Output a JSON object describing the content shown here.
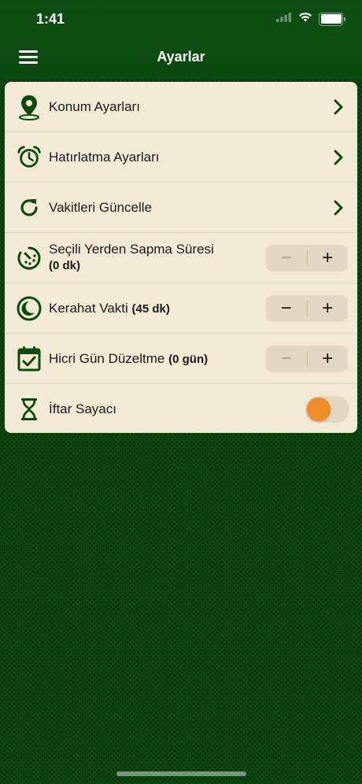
{
  "status_bar": {
    "time": "1:41"
  },
  "nav": {
    "title": "Ayarlar",
    "menu_icon": "hamburger-menu-icon"
  },
  "colors": {
    "header_green": "#0d4f12",
    "background_green": "#0d4a10",
    "card_bg": "#f2ead5",
    "icon_green": "#0d4a10",
    "toggle_knob": "#f08c2a"
  },
  "settings": {
    "location": {
      "label": "Konum Ayarları",
      "icon": "location-pin-icon"
    },
    "reminder": {
      "label": "Hatırlatma Ayarları",
      "icon": "alarm-clock-icon"
    },
    "update": {
      "label": "Vakitleri Güncelle",
      "icon": "refresh-icon"
    },
    "deviation": {
      "label": "Seçili Yerden Sapma Süresi",
      "value": "(0 dk)",
      "icon": "timer-icon",
      "minus": "−",
      "plus": "+"
    },
    "kerahat": {
      "label": "Kerahat Vakti",
      "value": "(45 dk)",
      "icon": "moon-clock-icon",
      "minus": "−",
      "plus": "+"
    },
    "hijri": {
      "label": "Hicri Gün Düzeltme",
      "value": "(0 gün)",
      "icon": "calendar-check-icon",
      "minus": "−",
      "plus": "+"
    },
    "iftar": {
      "label": "İftar Sayacı",
      "icon": "hourglass-icon",
      "enabled": false
    }
  }
}
